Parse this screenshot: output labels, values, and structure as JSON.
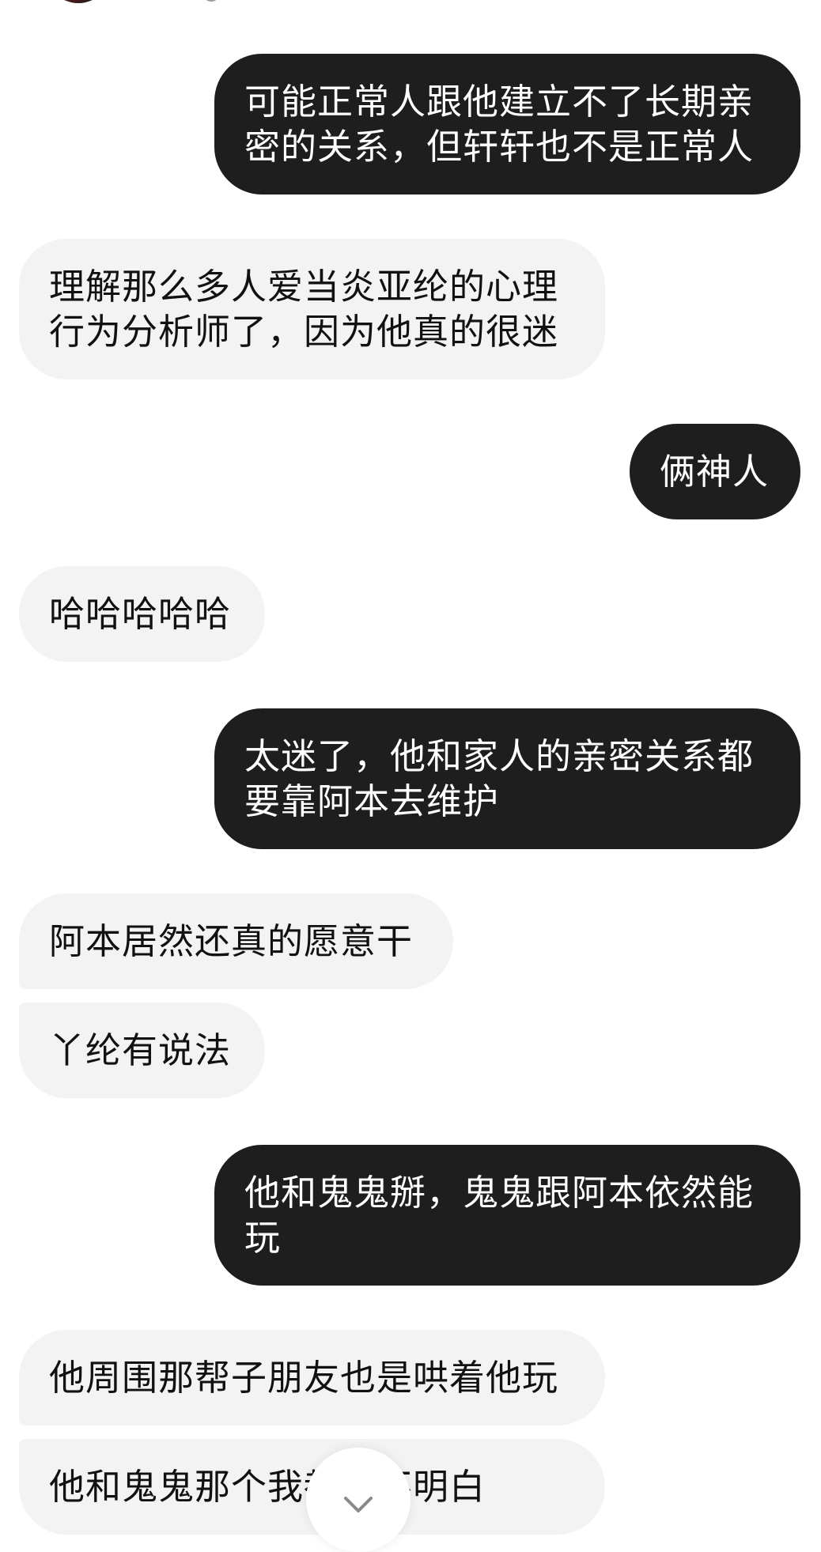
{
  "conversation": {
    "messages": [
      {
        "side": "right",
        "text": "可能正常人跟他建立不了长期亲\n密的关系，但轩轩也不是正常人"
      },
      {
        "side": "left",
        "text": "理解那么多人爱当炎亚纶的心理\n行为分析师了，因为他真的很迷"
      },
      {
        "side": "right",
        "text": "俩神人"
      },
      {
        "side": "left",
        "text": "哈哈哈哈哈"
      },
      {
        "side": "right",
        "text": "太迷了，他和家人的亲密关系都\n要靠阿本去维护"
      },
      {
        "side": "left",
        "text": "阿本居然还真的愿意干"
      },
      {
        "side": "left",
        "text": "丫纶有说法"
      },
      {
        "side": "right",
        "text": "他和鬼鬼掰，鬼鬼跟阿本依然能\n玩"
      },
      {
        "side": "left",
        "text": "他周围那帮子朋友也是哄着他玩"
      },
      {
        "side": "left",
        "text": "他和鬼鬼那个我都看不明白"
      }
    ]
  },
  "icons": {
    "scroll_down": "chevron-down-icon"
  },
  "colors": {
    "outgoing_bubble": "#1e1e1e",
    "incoming_bubble": "#f3f3f3",
    "outgoing_text": "#ffffff",
    "incoming_text": "#111111"
  }
}
